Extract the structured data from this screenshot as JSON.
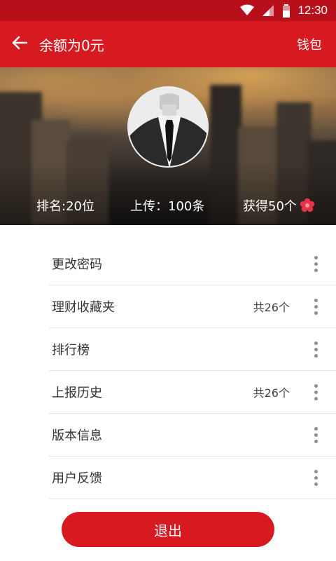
{
  "status_bar": {
    "time": "12:30",
    "icons": [
      "wifi-icon",
      "signal-icon",
      "battery-icon"
    ]
  },
  "app_bar": {
    "title": "余额为0元",
    "action_label": "钱包",
    "back_icon": "arrow-left-icon"
  },
  "profile": {
    "rank": "排名:20位",
    "uploads": "上传：100条",
    "earned": "获得50个",
    "earned_icon": "flower-icon"
  },
  "menu": {
    "items": [
      {
        "label": "更改密码",
        "count": ""
      },
      {
        "label": "理财收藏夹",
        "count": "共26个"
      },
      {
        "label": "排行榜",
        "count": ""
      },
      {
        "label": "上报历史",
        "count": "共26个"
      },
      {
        "label": "版本信息",
        "count": ""
      },
      {
        "label": "用户反馈",
        "count": ""
      }
    ],
    "more_icon": "more-vertical-icon"
  },
  "logout_label": "退出",
  "colors": {
    "primary": "#d71920",
    "status_bar": "#b8101a",
    "divider": "#e4e4e4",
    "text": "#333333"
  }
}
